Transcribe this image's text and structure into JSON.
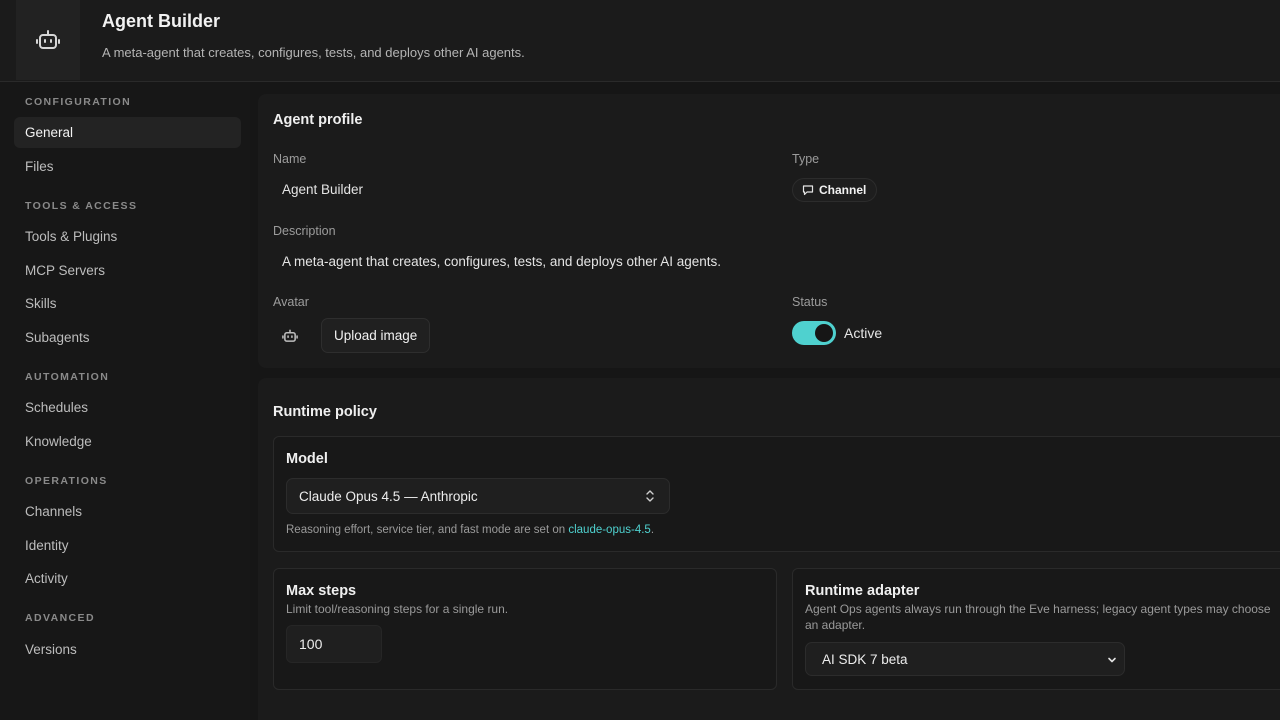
{
  "header": {
    "title": "Agent Builder",
    "subtitle": "A meta-agent that creates, configures, tests, and deploys other AI agents.",
    "logo_icon": "robot-icon"
  },
  "sidebar": {
    "sections": {
      "configuration": "CONFIGURATION",
      "tools_access": "TOOLS & ACCESS",
      "automation": "AUTOMATION",
      "operations": "OPERATIONS",
      "advanced": "ADVANCED"
    },
    "items": {
      "general": "General",
      "files": "Files",
      "tools_plugins": "Tools & Plugins",
      "mcp_servers": "MCP Servers",
      "skills": "Skills",
      "subagents": "Subagents",
      "schedules": "Schedules",
      "knowledge": "Knowledge",
      "channels": "Channels",
      "identity": "Identity",
      "activity": "Activity",
      "versions": "Versions"
    },
    "active": "General"
  },
  "profile": {
    "title": "Agent profile",
    "name_label": "Name",
    "name_value": "Agent Builder",
    "type_label": "Type",
    "type_value": "Channel",
    "type_icon": "chat-bubble-icon",
    "description_label": "Description",
    "description_value": "A meta-agent that creates, configures, tests, and deploys other AI agents.",
    "avatar_label": "Avatar",
    "avatar_icon": "robot-icon",
    "upload_label": "Upload image",
    "status_label": "Status",
    "status_value": "Active",
    "status_on": true
  },
  "runtime": {
    "title": "Runtime policy",
    "model": {
      "title": "Model",
      "selected": "Claude Opus 4.5 — Anthropic",
      "hint_prefix": "Reasoning effort, service tier, and fast mode are set on ",
      "hint_link": "claude-opus-4.5",
      "hint_suffix": "."
    },
    "max_steps": {
      "title": "Max steps",
      "description": "Limit tool/reasoning steps for a single run.",
      "value": "100"
    },
    "adapter": {
      "title": "Runtime adapter",
      "description": "Agent Ops agents always run through the Eve harness; legacy agent types may choose an adapter.",
      "selected": "AI SDK 7 beta"
    }
  },
  "colors": {
    "accent": "#4fd1cf",
    "background": "#161616",
    "card": "#1b1b1b"
  }
}
